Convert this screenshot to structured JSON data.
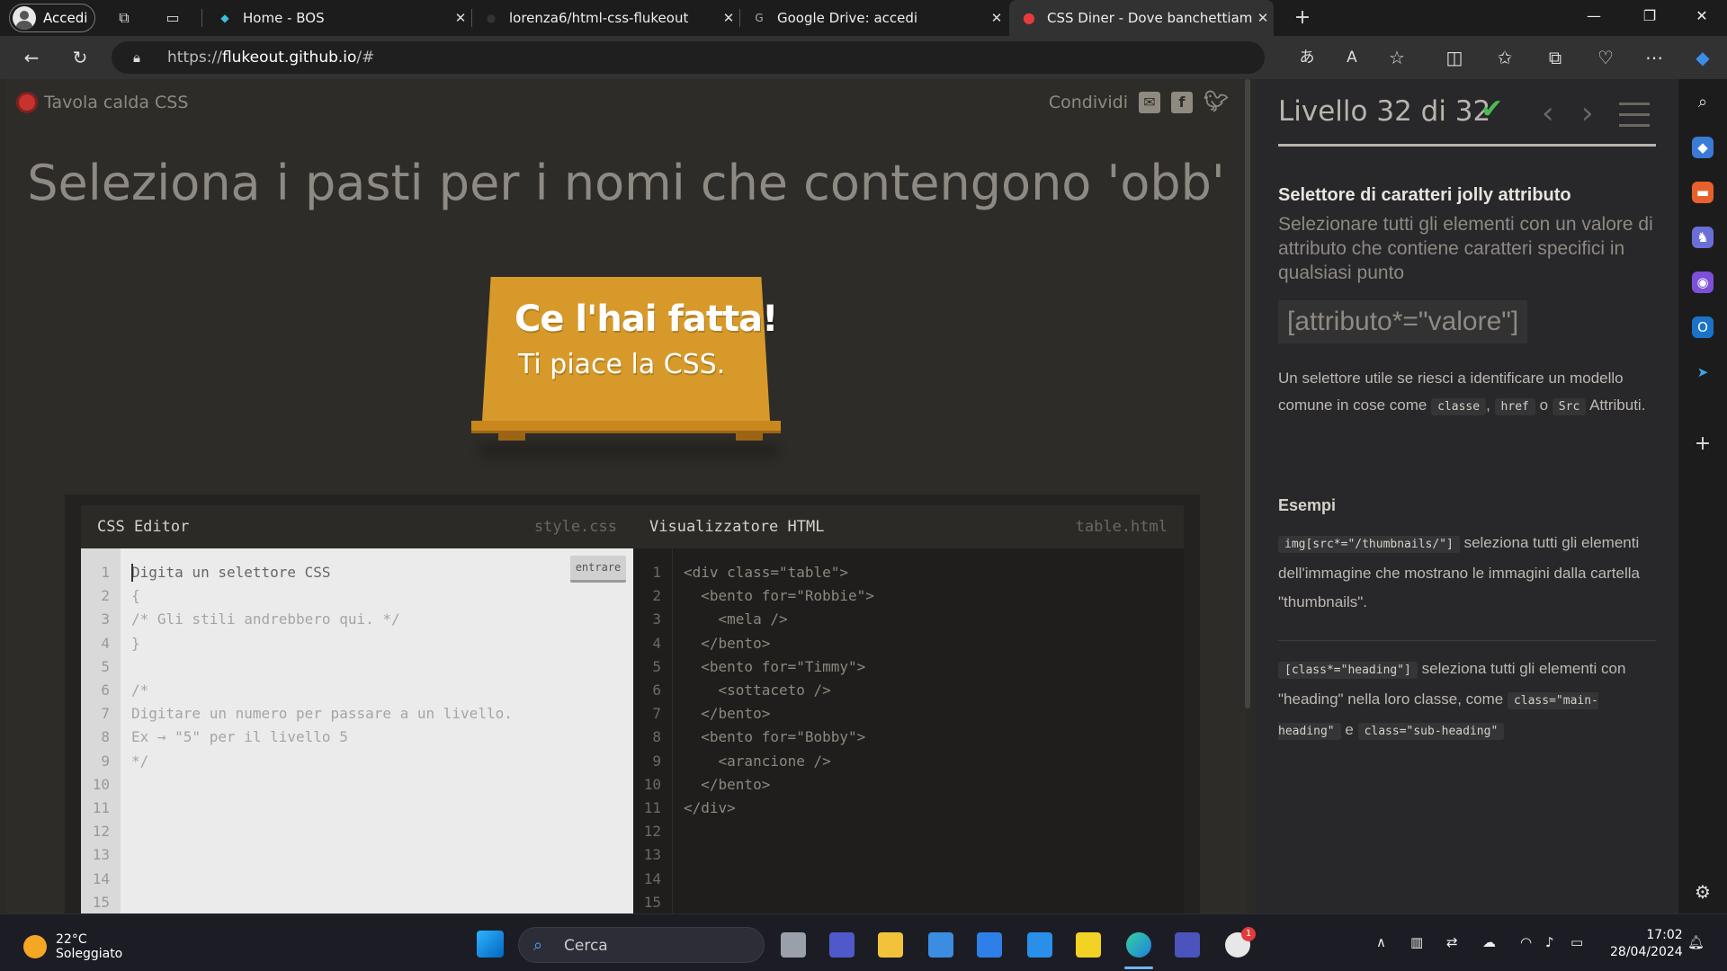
{
  "browser": {
    "profile_label": "Accedi",
    "tabs": [
      {
        "title": "Home - BOS",
        "active": false
      },
      {
        "title": "lorenza6/html-css-flukeout",
        "active": false
      },
      {
        "title": "Google Drive: accedi",
        "active": false
      },
      {
        "title": "CSS Diner - Dove banchettiamo",
        "active": true
      }
    ],
    "url_prefix": "https://",
    "url_host": "flukeout.github.io",
    "url_path": "/#"
  },
  "site": {
    "logo_text": "Tavola calda CSS",
    "share_label": "Condividi",
    "order_title": "Seleziona i pasti per i nomi che contengono 'obb'",
    "win_line1": "Ce l'hai fatta!",
    "win_line2": "Ti piace la CSS."
  },
  "editor": {
    "css_title": "CSS Editor",
    "css_file": "style.css",
    "html_title": "Visualizzatore HTML",
    "html_file": "table.html",
    "enter_label": "entrare",
    "line_numbers": [
      "1",
      "2",
      "3",
      "4",
      "5",
      "6",
      "7",
      "8",
      "9",
      "10",
      "11",
      "12",
      "13",
      "14",
      "15"
    ],
    "css_lines": [
      "Digita un selettore CSS",
      "{",
      "/* Gli stili andrebbero qui. */",
      "}",
      "",
      "/*",
      "Digitare un numero per passare a un livello.",
      "Ex → \"5\" per il livello 5",
      "*/"
    ],
    "html_lines": [
      "<div class=\"table\">",
      "  <bento for=\"Robbie\">",
      "    <mela />",
      "  </bento>",
      "  <bento for=\"Timmy\">",
      "    <sottaceto />",
      "  </bento>",
      "  <bento for=\"Bobby\">",
      "    <arancione />",
      "  </bento>",
      "</div>"
    ]
  },
  "panel": {
    "level_title": "Livello 32 di 32",
    "progress": 1.0,
    "selector_name": "Selettore di caratteri jolly attributo",
    "selector_hint": "Selezionare tutti gli elementi con un valore di attributo che contiene caratteri specifici in qualsiasi punto",
    "syntax": "[attributo*=\"valore\"]",
    "desc_text": "Un selettore utile se riesci a identificare un modello comune in cose come",
    "desc_tag1": "classe",
    "desc_sep": ",",
    "desc_tag2": "href",
    "desc_or": "o",
    "desc_tag3": "Src",
    "desc_end": "Attributi.",
    "examples_heading": "Esempi",
    "ex1_code": "img[src*=\"/thumbnails/\"]",
    "ex1_text": "seleziona tutti gli elementi dell'immagine che mostrano le immagini dalla cartella \"thumbnails\".",
    "ex2_code": "[class*=\"heading\"]",
    "ex2_text": "seleziona tutti gli elementi con \"heading\" nella loro classe, come",
    "ex2_code2": "class=\"main-heading\"",
    "ex2_and": "e",
    "ex2_code3": "class=\"sub-heading\""
  },
  "taskbar": {
    "temperature": "22°C",
    "weather": "Soleggiato",
    "search_label": "Cerca",
    "time": "17:02",
    "date": "28/04/2024",
    "badge_count": "1"
  },
  "colors": {
    "accent_check": "#4cbb54",
    "table_wood": "#d79a2a",
    "logo_red": "#c8322e"
  }
}
